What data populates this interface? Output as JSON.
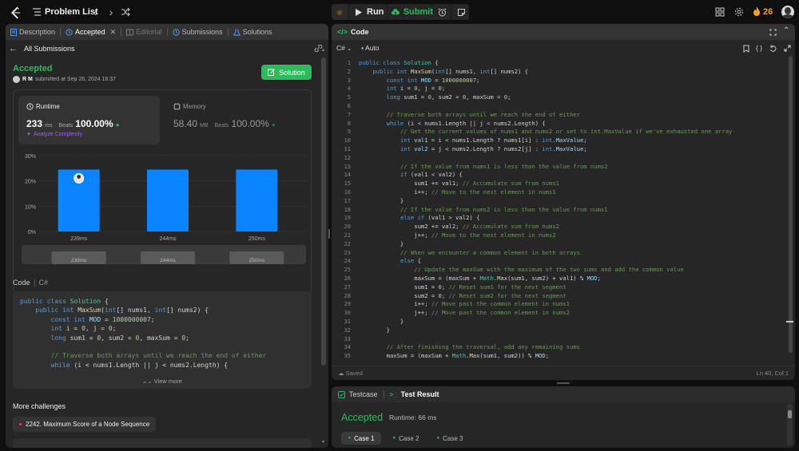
{
  "topbar": {
    "title": "Problem List",
    "run_label": "Run",
    "submit_label": "Submit",
    "streak_count": "26"
  },
  "left": {
    "tabs": [
      {
        "label": "Description"
      },
      {
        "label": "Accepted"
      },
      {
        "label": "Editorial"
      },
      {
        "label": "Submissions"
      },
      {
        "label": "Solutions"
      }
    ],
    "all_submissions": "All Submissions",
    "status": "Accepted",
    "user": "R M",
    "submitted_text": "submitted at Sep 26, 2024 16:37",
    "solution_button": "Solution",
    "runtime": {
      "title": "Runtime",
      "value": "233",
      "unit": "ms",
      "beats_label": "Beats",
      "beats": "100.00%",
      "analyze": "Analyze Complexity"
    },
    "memory": {
      "title": "Memory",
      "value": "58.40",
      "unit": "MB",
      "beats_label": "Beats",
      "beats": "100.00%"
    },
    "code_label": "Code",
    "code_lang": "C#",
    "view_more": "View more",
    "more_challenges": "More challenges",
    "challenge": "2242. Maximum Score of a Node Sequence"
  },
  "chart_data": {
    "type": "bar",
    "categories": [
      "239ms",
      "244ms",
      "250ms"
    ],
    "values": [
      24.5,
      24.5,
      24.5
    ],
    "y_ticks": [
      "30%",
      "20%",
      "10%",
      "0%"
    ],
    "ylim": [
      0,
      30
    ],
    "color": "#0a84ff",
    "minimap_labels": [
      "239ms",
      "244ms",
      "250ms"
    ]
  },
  "right": {
    "code_title": "Code",
    "lang": "C#",
    "auto": "Auto",
    "saved": "Saved",
    "cursor": "Ln 40, Col 1",
    "testcase_label": "Testcase",
    "result_label": "Test Result",
    "result_status": "Accepted",
    "result_runtime": "Runtime: 66 ms",
    "cases": [
      "Case 1",
      "Case 2",
      "Case 3"
    ]
  },
  "colors": {
    "accent_green": "#2cbb5d",
    "bar_blue": "#0a84ff",
    "streak_orange": "#ffa116"
  }
}
